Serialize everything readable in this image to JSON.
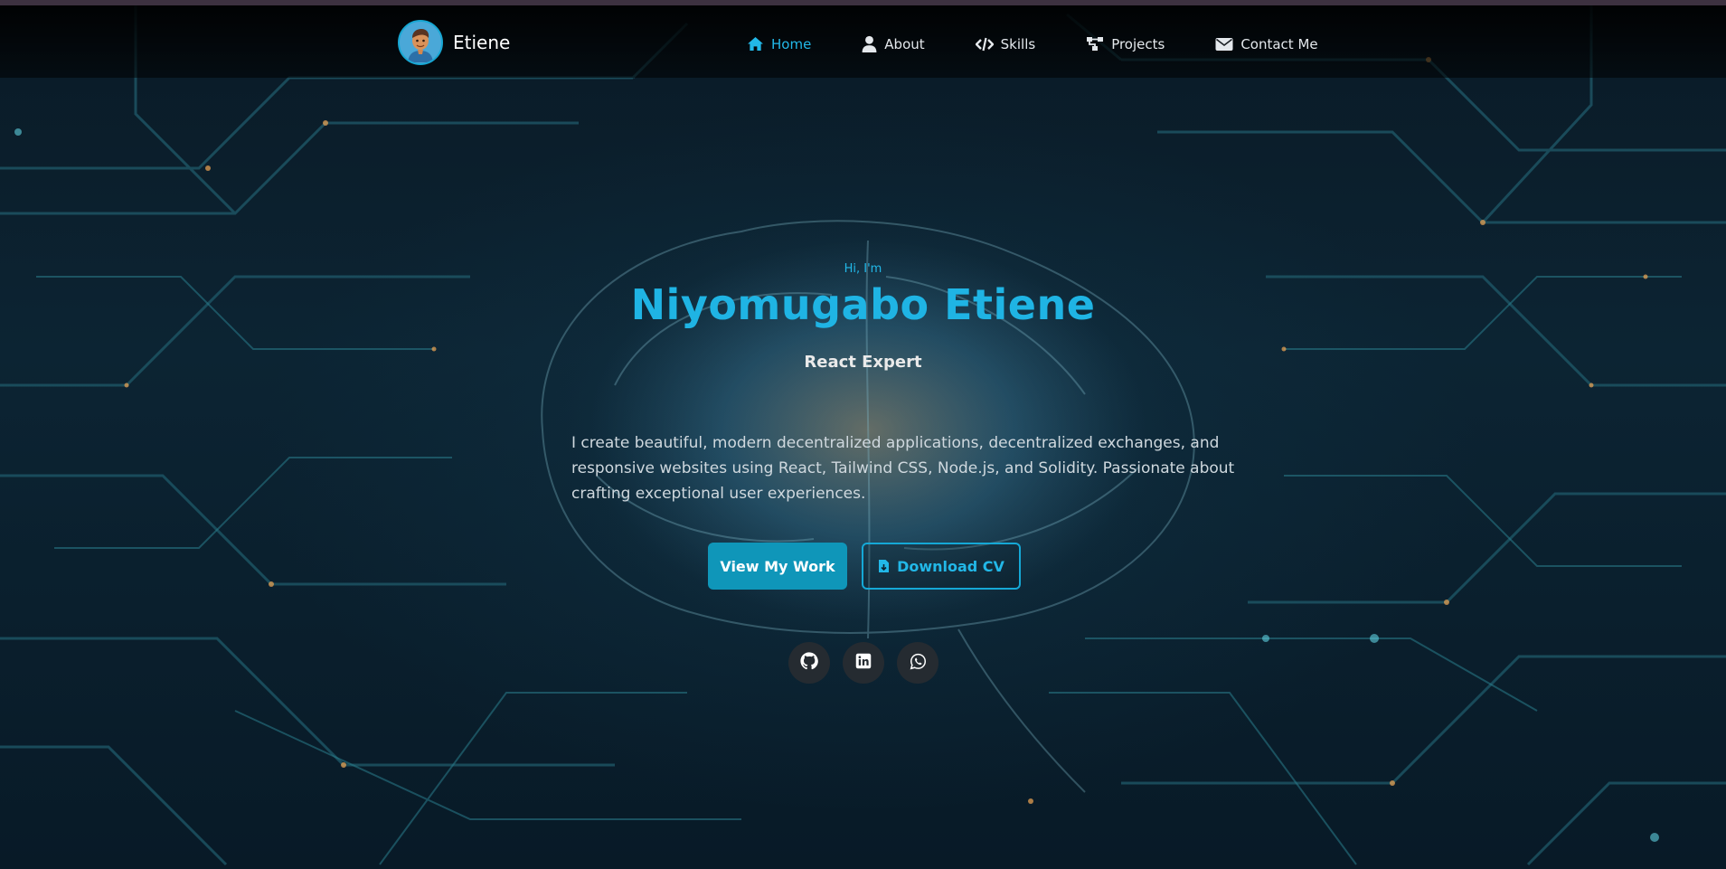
{
  "brand": {
    "name": "Etiene",
    "avatar_icon": "avatar-icon"
  },
  "nav": {
    "items": [
      {
        "label": "Home",
        "icon": "home-icon",
        "active": true
      },
      {
        "label": "About",
        "icon": "user-icon",
        "active": false
      },
      {
        "label": "Skills",
        "icon": "code-icon",
        "active": false
      },
      {
        "label": "Projects",
        "icon": "sitemap-icon",
        "active": false
      },
      {
        "label": "Contact Me",
        "icon": "envelope-icon",
        "active": false
      }
    ]
  },
  "hero": {
    "greeting": "Hi, I'm",
    "name": "Niyomugabo Etiene",
    "role": "React Expert",
    "description": "I create beautiful, modern decentralized applications, decentralized exchanges, and responsive websites using React, Tailwind CSS, Node.js, and Solidity. Passionate about crafting exceptional user experiences.",
    "primary_button": "View My Work",
    "secondary_button": "Download CV",
    "secondary_icon": "file-download-icon"
  },
  "social": [
    {
      "icon": "github-icon"
    },
    {
      "icon": "linkedin-icon"
    },
    {
      "icon": "whatsapp-icon"
    }
  ],
  "colors": {
    "accent": "#1fb4e4",
    "button_bg": "#0f96b9",
    "social_bg": "#252b31",
    "background": "#06141f"
  }
}
